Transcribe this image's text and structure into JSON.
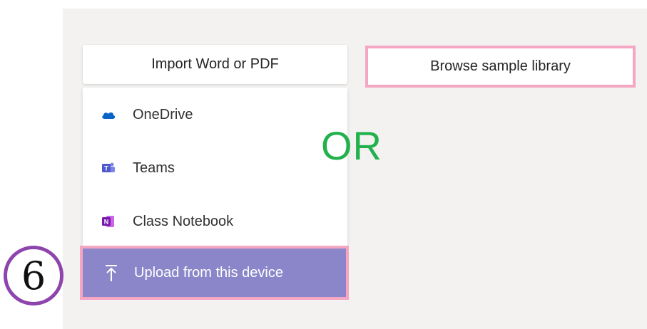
{
  "import_button": {
    "label": "Import Word or PDF"
  },
  "browse_button": {
    "label": "Browse sample library"
  },
  "menu": {
    "items": [
      {
        "label": "OneDrive",
        "icon": "onedrive-cloud-icon"
      },
      {
        "label": "Teams",
        "icon": "teams-icon"
      },
      {
        "label": "Class Notebook",
        "icon": "class-notebook-icon"
      },
      {
        "label": "Upload from this device",
        "icon": "upload-arrow-icon"
      }
    ]
  },
  "annotation": {
    "or_text": "OR",
    "step_number": "6"
  },
  "colors": {
    "highlight_border": "#f4a6c3",
    "upload_bg": "#8b86c9",
    "or_green": "#22b14c",
    "circle_purple": "#8e44ad",
    "onedrive_blue": "#0a64c8",
    "teams_purple": "#5059c9",
    "onenote_purple": "#7719aa"
  }
}
